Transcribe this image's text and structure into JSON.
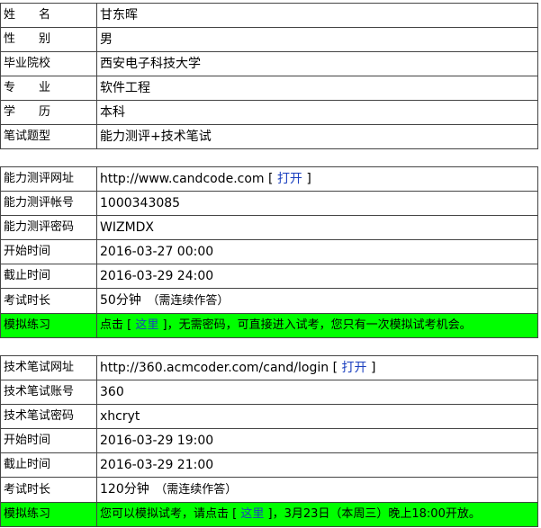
{
  "personal": [
    {
      "label": "姓　　名",
      "value": "甘东晖"
    },
    {
      "label": "性　　别",
      "value": "男"
    },
    {
      "label": "毕业院校",
      "value": "西安电子科技大学"
    },
    {
      "label": "专　　业",
      "value": "软件工程"
    },
    {
      "label": "学　　历",
      "value": "本科"
    },
    {
      "label": "笔试题型",
      "value": "能力测评+技术笔试"
    }
  ],
  "ability": {
    "url_label": "能力测评网址",
    "url": "http://www.candcode.com",
    "url_open_prefix": " [ ",
    "url_open": "打开",
    "url_open_suffix": " ]",
    "account_label": "能力测评帐号",
    "account": "1000343085",
    "password_label": "能力测评密码",
    "password": "WIZMDX",
    "start_label": "开始时间",
    "start": "2016-03-27 00:00",
    "end_label": "截止时间",
    "end": "2016-03-29 24:00",
    "duration_label": "考试时长",
    "duration": "50分钟",
    "duration_note": "　（需连续作答）",
    "mock_label": "模拟练习",
    "mock_prefix": "点击 [ ",
    "mock_link": "这里",
    "mock_suffix": " ]，无需密码，可直接进入试考，您只有一次模拟试考机会。"
  },
  "technical": {
    "url_label": "技术笔试网址",
    "url": "http://360.acmcoder.com/cand/login",
    "url_open_prefix": "  [ ",
    "url_open": "打开",
    "url_open_suffix": " ]",
    "account_label": "技术笔试账号",
    "account": "360",
    "password_label": "技术笔试密码",
    "password": "xhcryt",
    "start_label": "开始时间",
    "start": "2016-03-29 19:00",
    "end_label": "截止时间",
    "end": "2016-03-29 21:00",
    "duration_label": "考试时长",
    "duration": "120分钟",
    "duration_note": "　（需连续作答）",
    "mock_label": "模拟练习",
    "mock_prefix": "您可以模拟试考，请点击 [ ",
    "mock_link": "这里",
    "mock_suffix": " ]，3月23日（本周三）晚上18:00开放。"
  },
  "colors": {
    "highlight": "#00ff00",
    "link": "#1a3fbf",
    "border": "#444444"
  }
}
